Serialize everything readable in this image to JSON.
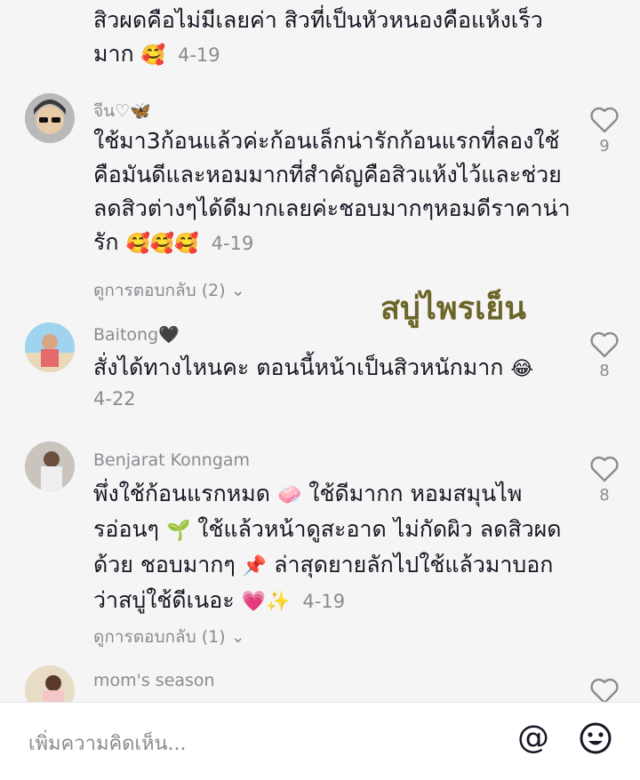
{
  "comments": [
    {
      "name": "",
      "text": "สิวผดคือไม่มีเลยค่า สิวที่เป็นหัวหนองคือแห้งเร็วมาก",
      "emoji": "🥰",
      "date": "4-19"
    },
    {
      "name": "จีน♡🦋",
      "text": "ใช้มา3ก้อนแล้วค่ะก้อนเล็กน่ารักก้อนแรกที่ลองใช้คือมันดีและหอมมากที่สำคัญคือสิวแห้งไว้และช่วยลดสิวต่างๆได้ดีมากเลยค่ะชอบมากๆหอมดีราคาน่ารัก",
      "emoji": "🥰🥰🥰",
      "date": "4-19",
      "likes": "9",
      "replies": "ดูการตอบกลับ (2)"
    },
    {
      "name": "Baitong🖤",
      "text": "สั่งได้ทางไหนคะ ตอนนี้หน้าเป็นสิวหนักมาก",
      "emoji": "😂",
      "date": "4-22",
      "likes": "8"
    },
    {
      "name": "Benjarat Konngam",
      "text1": "พึ่งใช้ก้อนแรกหมด",
      "emoji1": "🧼",
      "text2": "ใช้ดีมากก หอมสมุนไพรอ่อนๆ",
      "emoji2": "🌱",
      "text3": "ใช้แล้วหน้าดูสะอาด ไม่กัดผิว ลดสิวผดด้วย ชอบมากๆ",
      "emoji3": "📌",
      "text4": "ล่าสุดยายลักไปใช้แล้วมาบอกว่าสบู่ใช้ดีเนอะ",
      "emoji4": "💗✨",
      "date": "4-19",
      "likes": "8",
      "replies": "ดูการตอบกลับ (1)"
    },
    {
      "name": "mom's season"
    }
  ],
  "overlay": "สบู่ไพรเย็น",
  "chevron": "⌄",
  "input_placeholder": "เพิ่มความคิดเห็น...",
  "at_symbol": "@",
  "icons": [
    "heart-outline-icon",
    "at-icon",
    "emoji-face-icon",
    "chevron-down-icon"
  ]
}
